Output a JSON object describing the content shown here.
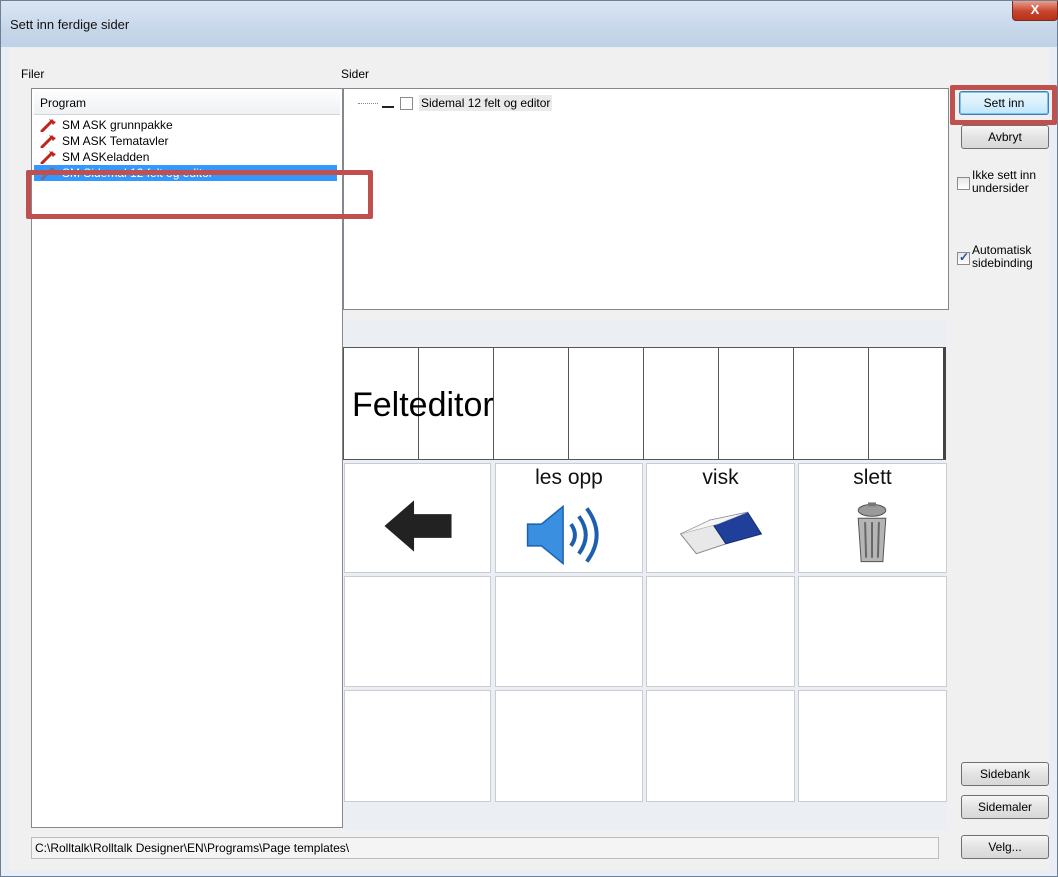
{
  "window": {
    "title": "Sett inn ferdige sider",
    "close_label": "X"
  },
  "filer": {
    "label": "Filer",
    "column_header": "Program",
    "items": [
      {
        "label": "SM ASK grunnpakke",
        "icon": "red-tool-icon"
      },
      {
        "label": "SM ASK Tematavler",
        "icon": "red-tool-icon"
      },
      {
        "label": "SM ASKeladden",
        "icon": "red-tool-icon"
      },
      {
        "label": "SM Sidemal 12 felt og editor",
        "icon": "blue-tool-icon",
        "selected": true
      }
    ]
  },
  "sider": {
    "label": "Sider",
    "tree": [
      {
        "label": "Sidemal 12 felt og editor",
        "checked": false
      }
    ]
  },
  "preview": {
    "editor_text": "Felteditor",
    "cells": [
      {
        "label": "",
        "icon": "arrow-left-icon"
      },
      {
        "label": "les opp",
        "icon": "speaker-icon"
      },
      {
        "label": "visk",
        "icon": "eraser-icon"
      },
      {
        "label": "slett",
        "icon": "trash-icon"
      }
    ]
  },
  "buttons": {
    "sett_inn": "Sett inn",
    "avbryt": "Avbryt",
    "sidebank": "Sidebank",
    "sidemaler": "Sidemaler",
    "velg": "Velg..."
  },
  "options": {
    "ikke_sett_inn": {
      "label": "Ikke sett inn undersider",
      "checked": false
    },
    "automatisk": {
      "label": "Automatisk sidebinding",
      "checked": true
    }
  },
  "path": "C:\\Rolltalk\\Rolltalk Designer\\EN\\Programs\\Page templates\\",
  "colors": {
    "highlight": "#c0504d",
    "selection": "#3399ff"
  }
}
